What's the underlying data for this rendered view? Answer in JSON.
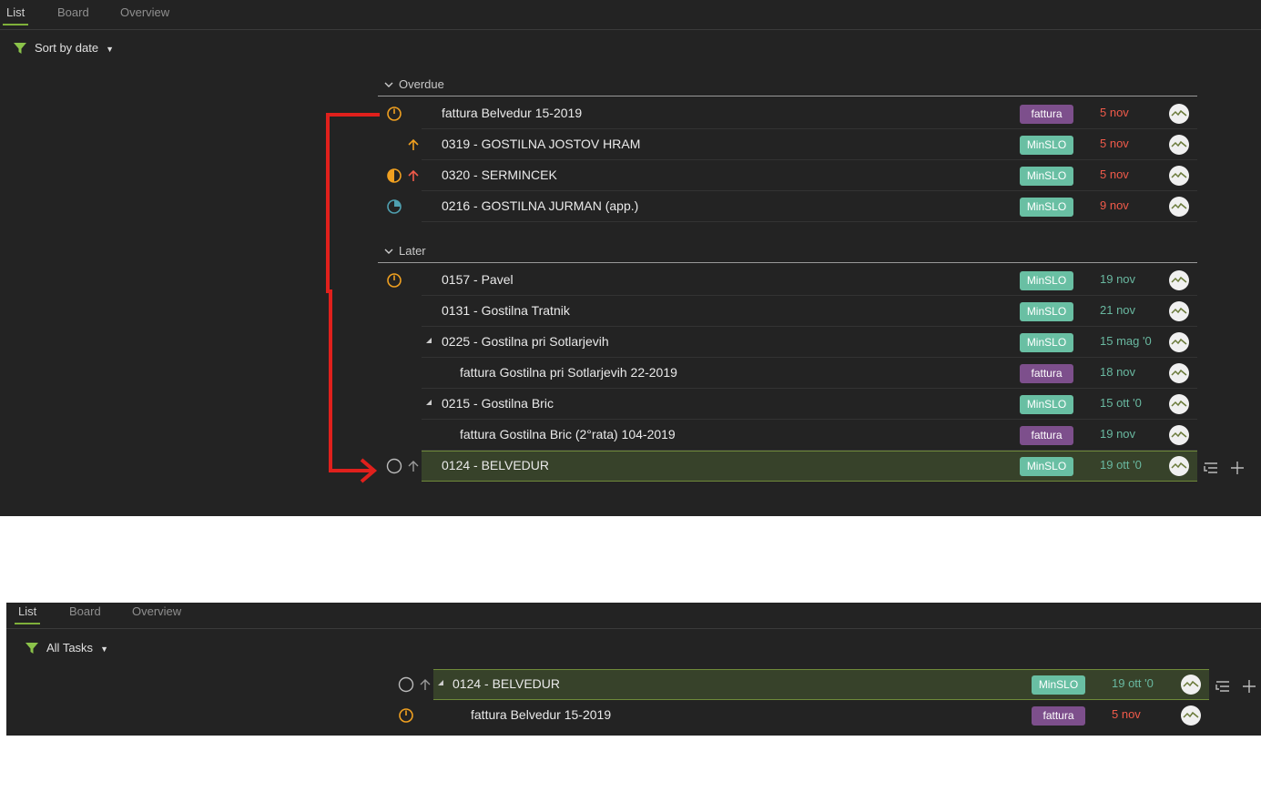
{
  "top": {
    "tabs": [
      "List",
      "Board",
      "Overview"
    ],
    "filter_label": "Sort by date",
    "overdue_label": "Overdue",
    "later_label": "Later",
    "overdue": [
      {
        "title": "fattura Belvedur 15-2019",
        "tag": "fattura",
        "date": "5 nov"
      },
      {
        "title": "0319 - GOSTILNA JOSTOV HRAM",
        "tag": "MinSLO",
        "date": "5 nov"
      },
      {
        "title": "0320 - SERMINCEK",
        "tag": "MinSLO",
        "date": "5 nov"
      },
      {
        "title": "0216 - GOSTILNA JURMAN (app.)",
        "tag": "MinSLO",
        "date": "9 nov"
      }
    ],
    "later": [
      {
        "title": "0157 - Pavel",
        "tag": "MinSLO",
        "date": "19 nov"
      },
      {
        "title": "0131 - Gostilna Tratnik",
        "tag": "MinSLO",
        "date": "21 nov"
      },
      {
        "title": "0225 - Gostilna pri Sotlarjevih",
        "tag": "MinSLO",
        "date": "15 mag '0"
      },
      {
        "title": "fattura Gostilna pri Sotlarjevih 22-2019",
        "tag": "fattura",
        "date": "18 nov"
      },
      {
        "title": "0215 - Gostilna Bric",
        "tag": "MinSLO",
        "date": "15 ott '0"
      },
      {
        "title": "fattura Gostilna Bric (2°rata) 104-2019",
        "tag": "fattura",
        "date": "19 nov"
      },
      {
        "title": "0124 - BELVEDUR",
        "tag": "MinSLO",
        "date": "19 ott '0"
      }
    ]
  },
  "bottom": {
    "tabs": [
      "List",
      "Board",
      "Overview"
    ],
    "filter_label": "All Tasks",
    "rows": [
      {
        "title": "0124 - BELVEDUR",
        "tag": "MinSLO",
        "date": "19 ott '0"
      },
      {
        "title": "fattura Belvedur 15-2019",
        "tag": "fattura",
        "date": "5 nov"
      }
    ]
  },
  "colors": {
    "panel_bg": "#232323",
    "accent_green": "#7fb03a",
    "tag_fattura": "#7d4f8c",
    "tag_minslo": "#69bfa3",
    "date_overdue": "#f05a4a",
    "date_later": "#69b8a0",
    "annotation_arrow": "#e0201c"
  },
  "icons": {
    "filter": "funnel-icon",
    "status": [
      "clock-icon",
      "half-circle-icon",
      "quarter-circle-icon",
      "empty-circle-icon"
    ],
    "priority": "arrow-up-icon",
    "subtask": "subtask-list-icon",
    "add": "plus-icon",
    "avatar": "user-avatar"
  }
}
